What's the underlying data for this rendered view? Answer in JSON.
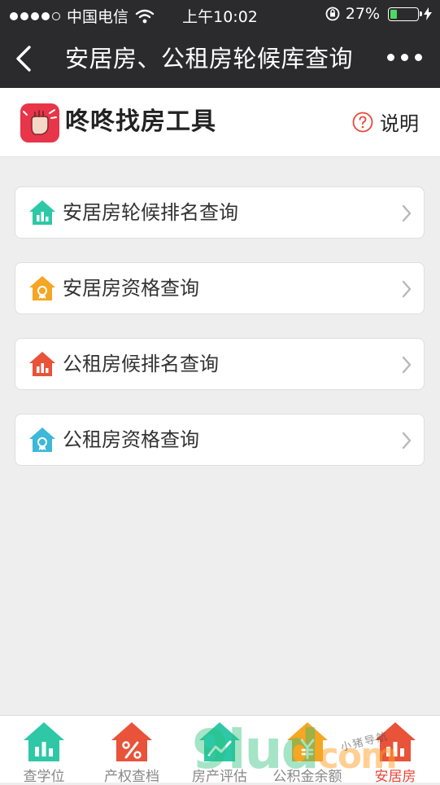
{
  "status_bar": {
    "carrier": "中国电信",
    "time": "上午10:02",
    "battery_percent": "27%",
    "battery_level": 0.27,
    "signal_dots_filled": 4,
    "signal_dots_total": 5
  },
  "nav": {
    "title": "安居房、公租房轮候库查询"
  },
  "brand": {
    "name": "咚咚找房工具",
    "help_label": "说明"
  },
  "menu": [
    {
      "label": "安居房轮候排名查询",
      "icon": "house-chart-icon",
      "color": "#2ec8a6"
    },
    {
      "label": " 安居房资格查询",
      "icon": "house-badge-icon",
      "color": "#f5a623"
    },
    {
      "label": "公租房候排名查询",
      "icon": "house-chart-icon",
      "color": "#e8533a"
    },
    {
      "label": "公租房资格查询",
      "icon": "house-badge-icon",
      "color": "#3cb8d8"
    }
  ],
  "tabs": [
    {
      "label": "查学位",
      "icon": "house-chart-icon",
      "color": "#2ec8a6"
    },
    {
      "label": "产权查档",
      "icon": "house-percent-icon",
      "color": "#e8533a"
    },
    {
      "label": "房产评估",
      "icon": "house-graph-icon",
      "color": "#2ec8a6"
    },
    {
      "label": "公积金余额",
      "icon": "house-yen-icon",
      "color": "#f5a623"
    },
    {
      "label": "安居房",
      "icon": "house-chart-icon",
      "color": "#e8533a",
      "active": true
    }
  ],
  "watermark": {
    "main": "9lud",
    "suffix": "com",
    "tagline": "小猪导航"
  },
  "colors": {
    "bar_dark": "#2b2b2d",
    "accent_red": "#e8473a",
    "battery_green": "#4cd964"
  }
}
